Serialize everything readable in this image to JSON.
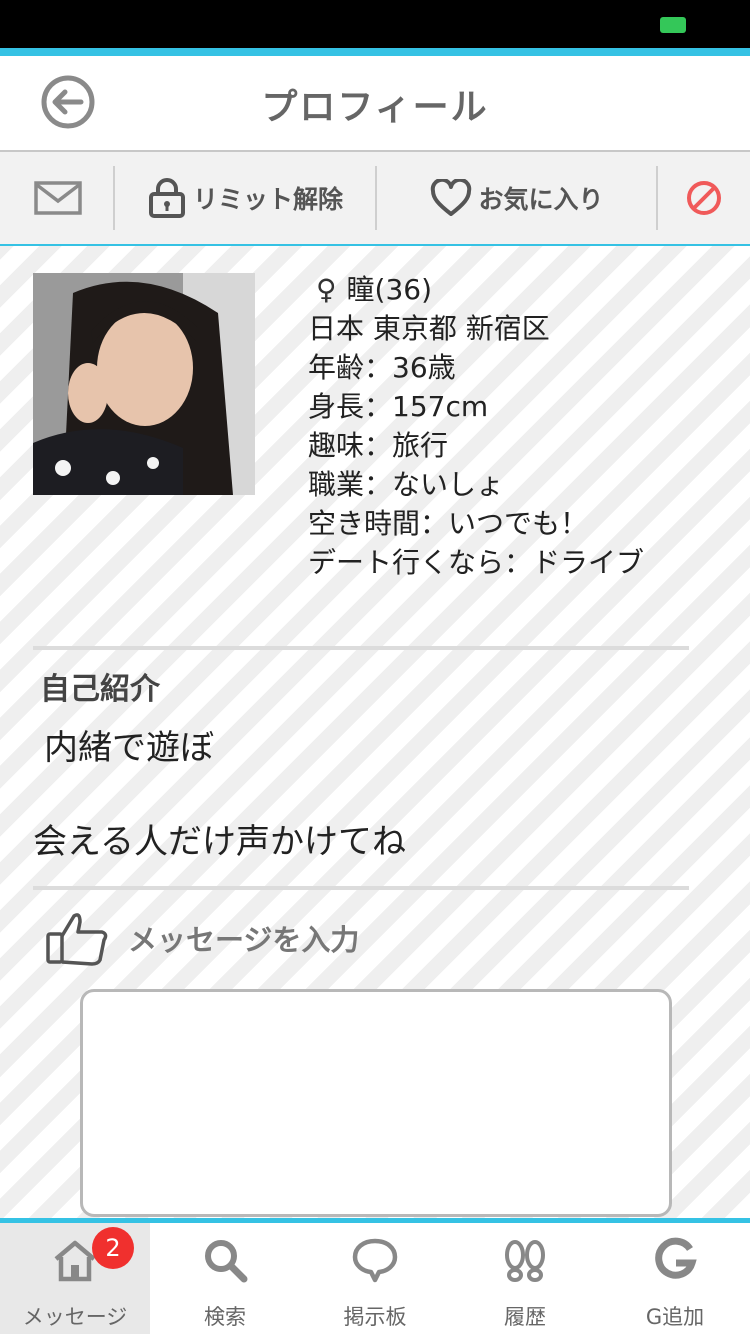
{
  "header": {
    "title": "プロフィール",
    "back_icon": "back-arrow-icon"
  },
  "actions": {
    "mail_icon": "mail-icon",
    "limit_label": "リミット解除",
    "favorite_label": "お気に入り",
    "block_icon": "block-icon"
  },
  "profile": {
    "gender_symbol": "♀",
    "name": "瞳(36)",
    "location": "日本 東京都 新宿区",
    "age": "年齢：36歳",
    "height": "身長：157cm",
    "hobby": "趣味：旅行",
    "job": "職業：ないしょ",
    "free_time": "空き時間：いつでも！",
    "date_pref": "デート行くなら：ドライブ"
  },
  "intro": {
    "title": "自己紹介",
    "line1": "内緒で遊ぼ",
    "line2": "会える人だけ声かけてね"
  },
  "message": {
    "label": "メッセージを入力",
    "icon": "thumbs-up-icon",
    "value": ""
  },
  "tabs": [
    {
      "label": "メッセージ",
      "icon": "home-icon",
      "badge": "2"
    },
    {
      "label": "検索",
      "icon": "search-icon"
    },
    {
      "label": "掲示板",
      "icon": "speech-bubble-icon"
    },
    {
      "label": "履歴",
      "icon": "footprints-icon"
    },
    {
      "label": "G追加",
      "icon": "g-icon"
    }
  ],
  "colors": {
    "accent": "#35c2e4",
    "badge": "#f0302e",
    "block": "#f05a5a"
  }
}
